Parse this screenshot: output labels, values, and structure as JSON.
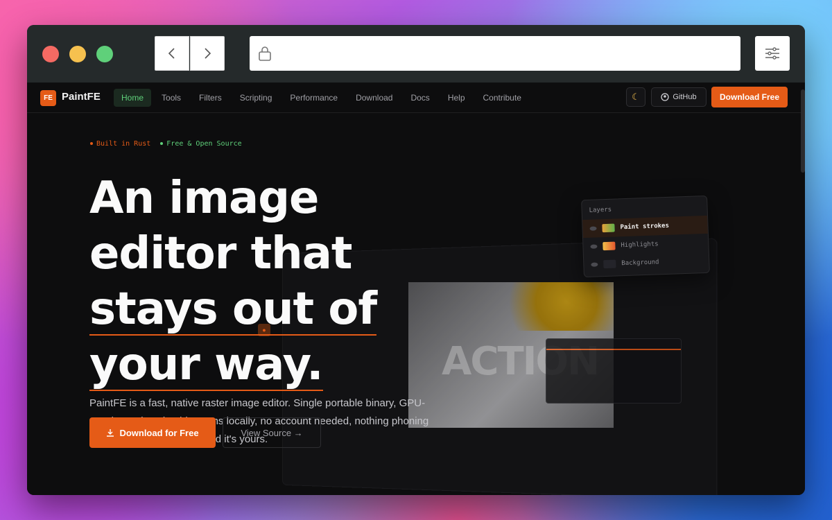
{
  "app": {
    "name": "PaintFE",
    "logo_text": "FE"
  },
  "nav": {
    "items": [
      {
        "label": "Home",
        "active": true
      },
      {
        "label": "Tools"
      },
      {
        "label": "Filters"
      },
      {
        "label": "Scripting"
      },
      {
        "label": "Performance"
      },
      {
        "label": "Download"
      },
      {
        "label": "Docs"
      },
      {
        "label": "Help"
      },
      {
        "label": "Contribute"
      }
    ],
    "theme_icon": "moon-icon",
    "github_label": "GitHub",
    "download_label": "Download Free"
  },
  "hero": {
    "tags": [
      "Built in Rust",
      "Free & Open Source"
    ],
    "headline_line1": "An image",
    "headline_line2": "editor that",
    "headline_line3": "stays out of",
    "headline_line4": "your way.",
    "description": "PaintFE is a fast, native raster image editor. Single portable binary, GPU-accelerated, scriptable. Runs locally, no account needed, nothing phoning home. Download it once and it's yours.",
    "primary_cta": "Download for Free",
    "secondary_cta": "View Source →"
  },
  "mock": {
    "canvas_text": "ACTION",
    "layers": {
      "title": "Layers",
      "items": [
        "Paint strokes",
        "Highlights",
        "Background"
      ]
    }
  },
  "colors": {
    "accent": "#e55b17",
    "active_nav": "#5fd07a",
    "background": "#0d0d0e"
  }
}
